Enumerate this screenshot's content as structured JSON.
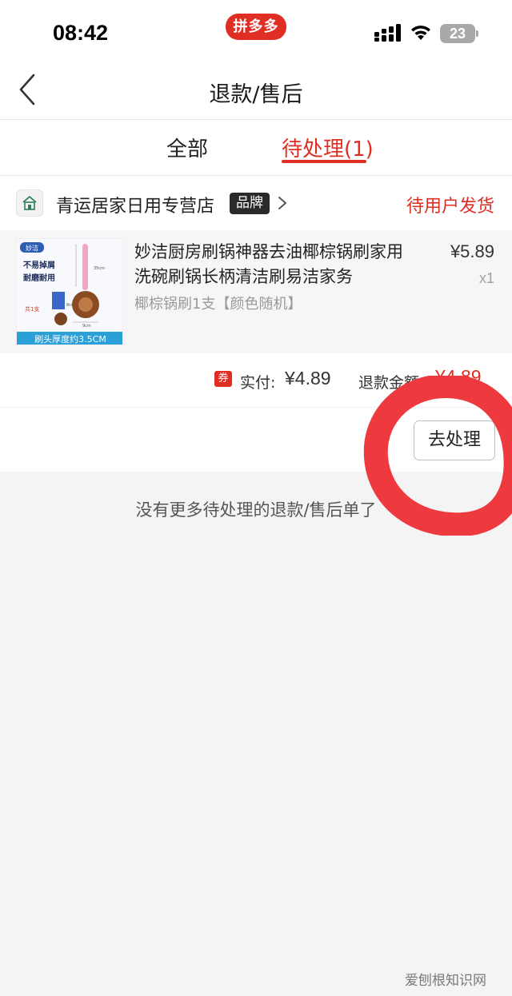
{
  "status_bar": {
    "time": "08:42",
    "app_badge": "拼多多",
    "battery": "23"
  },
  "nav": {
    "title": "退款/售后"
  },
  "tabs": [
    {
      "label": "全部",
      "active": false
    },
    {
      "label": "待处理(1)",
      "active": true
    }
  ],
  "order": {
    "store": {
      "name": "青运居家日用专营店",
      "badge": "品牌",
      "status": "待用户发货"
    },
    "product": {
      "title": "妙洁厨房刷锅神器去油椰棕锅刷家用洗碗刷锅长柄清洁刷易洁家务",
      "spec": "椰棕锅刷1支【颜色随机】",
      "price": "¥5.89",
      "quantity": "x1",
      "image_text": {
        "brand": "妙洁",
        "line1": "不易掉屑",
        "line2": "耐磨耐用",
        "count": "共1支",
        "bottom": "刷头厚度约3.5CM",
        "dim_height": "35cm",
        "dim_head": "8cm",
        "dim_width": "9cm"
      }
    },
    "amounts": {
      "coupon_icon": "券",
      "paid_label": "实付:",
      "paid_value": "¥4.89",
      "refund_label": "退款金额",
      "refund_value": "¥4.89"
    },
    "action_label": "去处理"
  },
  "empty_message": "没有更多待处理的退款/售后单了",
  "watermark": "爱刨根知识网",
  "colors": {
    "accent": "#e02e24",
    "annotation": "#ee3a3f"
  }
}
